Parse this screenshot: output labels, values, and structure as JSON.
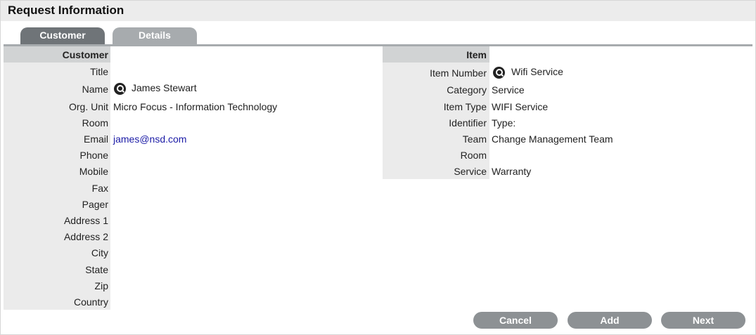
{
  "title": "Request Information",
  "tabs": [
    {
      "label": "Customer"
    },
    {
      "label": "Details"
    }
  ],
  "customer": {
    "header": "Customer",
    "fields": [
      {
        "label": "Title",
        "value": ""
      },
      {
        "label": "Name",
        "value": "James Stewart"
      },
      {
        "label": "Org. Unit",
        "value": "Micro Focus - Information Technology"
      },
      {
        "label": "Room",
        "value": ""
      },
      {
        "label": "Email",
        "value": "james@nsd.com"
      },
      {
        "label": "Phone",
        "value": ""
      },
      {
        "label": "Mobile",
        "value": ""
      },
      {
        "label": "Fax",
        "value": ""
      },
      {
        "label": "Pager",
        "value": ""
      },
      {
        "label": "Address 1",
        "value": ""
      },
      {
        "label": "Address 2",
        "value": ""
      },
      {
        "label": "City",
        "value": ""
      },
      {
        "label": "State",
        "value": ""
      },
      {
        "label": "Zip",
        "value": ""
      },
      {
        "label": "Country",
        "value": ""
      }
    ]
  },
  "item": {
    "header": "Item",
    "fields": [
      {
        "label": "Item Number",
        "value": "Wifi Service"
      },
      {
        "label": "Category",
        "value": "Service"
      },
      {
        "label": "Item Type",
        "value": "WIFI Service"
      },
      {
        "label": "Identifier",
        "value": "Type:"
      },
      {
        "label": "Team",
        "value": "Change Management Team"
      },
      {
        "label": "Room",
        "value": ""
      },
      {
        "label": "Service",
        "value": "Warranty"
      }
    ]
  },
  "buttons": {
    "cancel": "Cancel",
    "add": "Add",
    "next": "Next"
  }
}
